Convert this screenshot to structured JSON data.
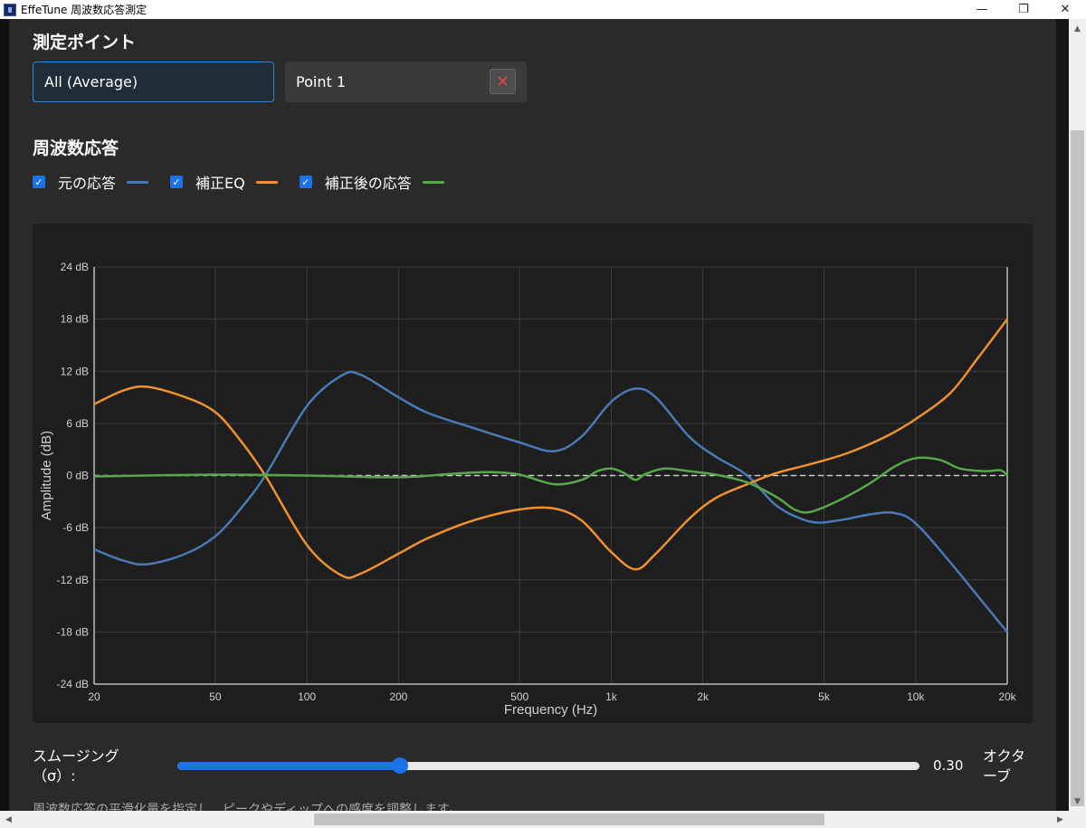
{
  "window": {
    "title": "EffeTune 周波数応答測定",
    "minimize_glyph": "—",
    "restore_glyph": "❐",
    "close_glyph": "✕"
  },
  "points": {
    "heading": "測定ポイント",
    "average_label": "All (Average)",
    "point1_label": "Point 1",
    "delete_glyph": "✕"
  },
  "frequency": {
    "heading": "周波数応答",
    "legend": [
      {
        "label": "元の応答",
        "color": "#4a7ab5",
        "checked": true
      },
      {
        "label": "補正EQ",
        "color": "#f0902f",
        "checked": true
      },
      {
        "label": "補正後の応答",
        "color": "#56a84a",
        "checked": true
      }
    ]
  },
  "smoothing": {
    "label": "スムージング（σ）:",
    "value_text": "0.30",
    "unit": "オクターブ",
    "fraction": 0.3,
    "help": "周波数応答の平滑化量を指定し、ピークやディップへの感度を調整します。"
  },
  "chart_data": {
    "type": "line",
    "xlabel": "Frequency (Hz)",
    "ylabel": "Amplitude (dB)",
    "xscale": "log",
    "xlim": [
      20,
      20000
    ],
    "ylim": [
      -24,
      24
    ],
    "grid": true,
    "x_ticks": [
      20,
      50,
      100,
      200,
      500,
      1000,
      2000,
      5000,
      10000,
      20000
    ],
    "x_tick_labels": [
      "20",
      "50",
      "100",
      "200",
      "500",
      "1k",
      "2k",
      "5k",
      "10k",
      "20k"
    ],
    "y_ticks": [
      24,
      18,
      12,
      6,
      0,
      -6,
      -12,
      -18,
      -24
    ],
    "y_tick_labels": [
      "24 dB",
      "18 dB",
      "12 dB",
      "6 dB",
      "0 dB",
      "-6 dB",
      "-12 dB",
      "-18 dB",
      "-24 dB"
    ],
    "reference_line": 0,
    "series": [
      {
        "name": "元の応答",
        "color": "#4a7ab5",
        "points": [
          [
            20,
            -8.5
          ],
          [
            25,
            -9.8
          ],
          [
            30,
            -10.2
          ],
          [
            40,
            -9
          ],
          [
            50,
            -7
          ],
          [
            60,
            -4
          ],
          [
            73,
            0
          ],
          [
            100,
            8
          ],
          [
            130,
            11.5
          ],
          [
            150,
            11.6
          ],
          [
            200,
            9
          ],
          [
            250,
            7.2
          ],
          [
            350,
            5.5
          ],
          [
            500,
            3.8
          ],
          [
            650,
            2.8
          ],
          [
            800,
            4.5
          ],
          [
            1000,
            8.5
          ],
          [
            1200,
            10
          ],
          [
            1400,
            9
          ],
          [
            1800,
            4.5
          ],
          [
            2200,
            2.2
          ],
          [
            2800,
            0
          ],
          [
            3500,
            -3.5
          ],
          [
            4500,
            -5.3
          ],
          [
            5500,
            -5.2
          ],
          [
            7000,
            -4.5
          ],
          [
            8500,
            -4.3
          ],
          [
            10000,
            -5.5
          ],
          [
            13000,
            -10
          ],
          [
            17000,
            -15
          ],
          [
            20000,
            -18
          ]
        ]
      },
      {
        "name": "補正EQ",
        "color": "#f0902f",
        "points": [
          [
            20,
            8.2
          ],
          [
            25,
            9.8
          ],
          [
            30,
            10.2
          ],
          [
            40,
            9
          ],
          [
            50,
            7.3
          ],
          [
            60,
            4.2
          ],
          [
            73,
            0
          ],
          [
            100,
            -8
          ],
          [
            130,
            -11.5
          ],
          [
            150,
            -11.3
          ],
          [
            200,
            -9
          ],
          [
            250,
            -7.2
          ],
          [
            350,
            -5.2
          ],
          [
            500,
            -3.9
          ],
          [
            650,
            -3.8
          ],
          [
            800,
            -5.2
          ],
          [
            1000,
            -8.8
          ],
          [
            1200,
            -10.8
          ],
          [
            1400,
            -9
          ],
          [
            1800,
            -5
          ],
          [
            2200,
            -2.6
          ],
          [
            2800,
            -1
          ],
          [
            3500,
            0.3
          ],
          [
            4500,
            1.3
          ],
          [
            6000,
            2.6
          ],
          [
            8000,
            4.5
          ],
          [
            10000,
            6.5
          ],
          [
            13000,
            9.5
          ],
          [
            16000,
            13.5
          ],
          [
            20000,
            18
          ]
        ]
      },
      {
        "name": "補正後の応答",
        "color": "#56a84a",
        "points": [
          [
            20,
            -0.1
          ],
          [
            50,
            0.1
          ],
          [
            100,
            0
          ],
          [
            200,
            -0.2
          ],
          [
            300,
            0.2
          ],
          [
            400,
            0.4
          ],
          [
            500,
            0.1
          ],
          [
            650,
            -1
          ],
          [
            800,
            -0.5
          ],
          [
            900,
            0.5
          ],
          [
            1000,
            0.8
          ],
          [
            1100,
            0.3
          ],
          [
            1200,
            -0.5
          ],
          [
            1300,
            0.2
          ],
          [
            1500,
            0.8
          ],
          [
            1800,
            0.5
          ],
          [
            2200,
            0.1
          ],
          [
            2800,
            -0.8
          ],
          [
            3500,
            -2.5
          ],
          [
            4000,
            -3.9
          ],
          [
            4500,
            -4.2
          ],
          [
            5500,
            -3
          ],
          [
            7000,
            -1
          ],
          [
            8500,
            1
          ],
          [
            10000,
            2
          ],
          [
            12000,
            1.8
          ],
          [
            14000,
            0.8
          ],
          [
            17000,
            0.5
          ],
          [
            19000,
            0.6
          ],
          [
            20000,
            0
          ]
        ]
      }
    ]
  }
}
